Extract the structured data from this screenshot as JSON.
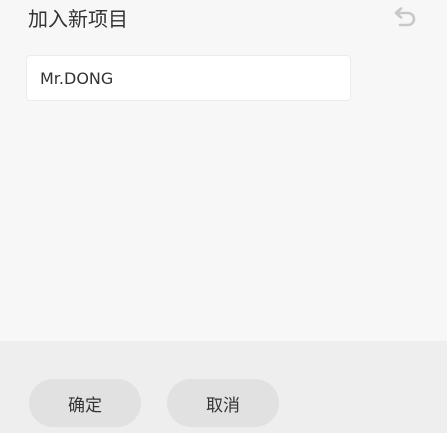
{
  "dialog": {
    "title": "加入新项目"
  },
  "name_input": {
    "value": "Mr.DONG"
  },
  "buttons": {
    "confirm_label": "确定",
    "cancel_label": "取消"
  },
  "icons": {
    "undo": "undo-arrow-icon"
  },
  "colors": {
    "background": "#f7f7f7",
    "footer": "#eeeeee",
    "button": "#e1e1e1",
    "text": "#333333",
    "icon": "#c8c8c8"
  }
}
